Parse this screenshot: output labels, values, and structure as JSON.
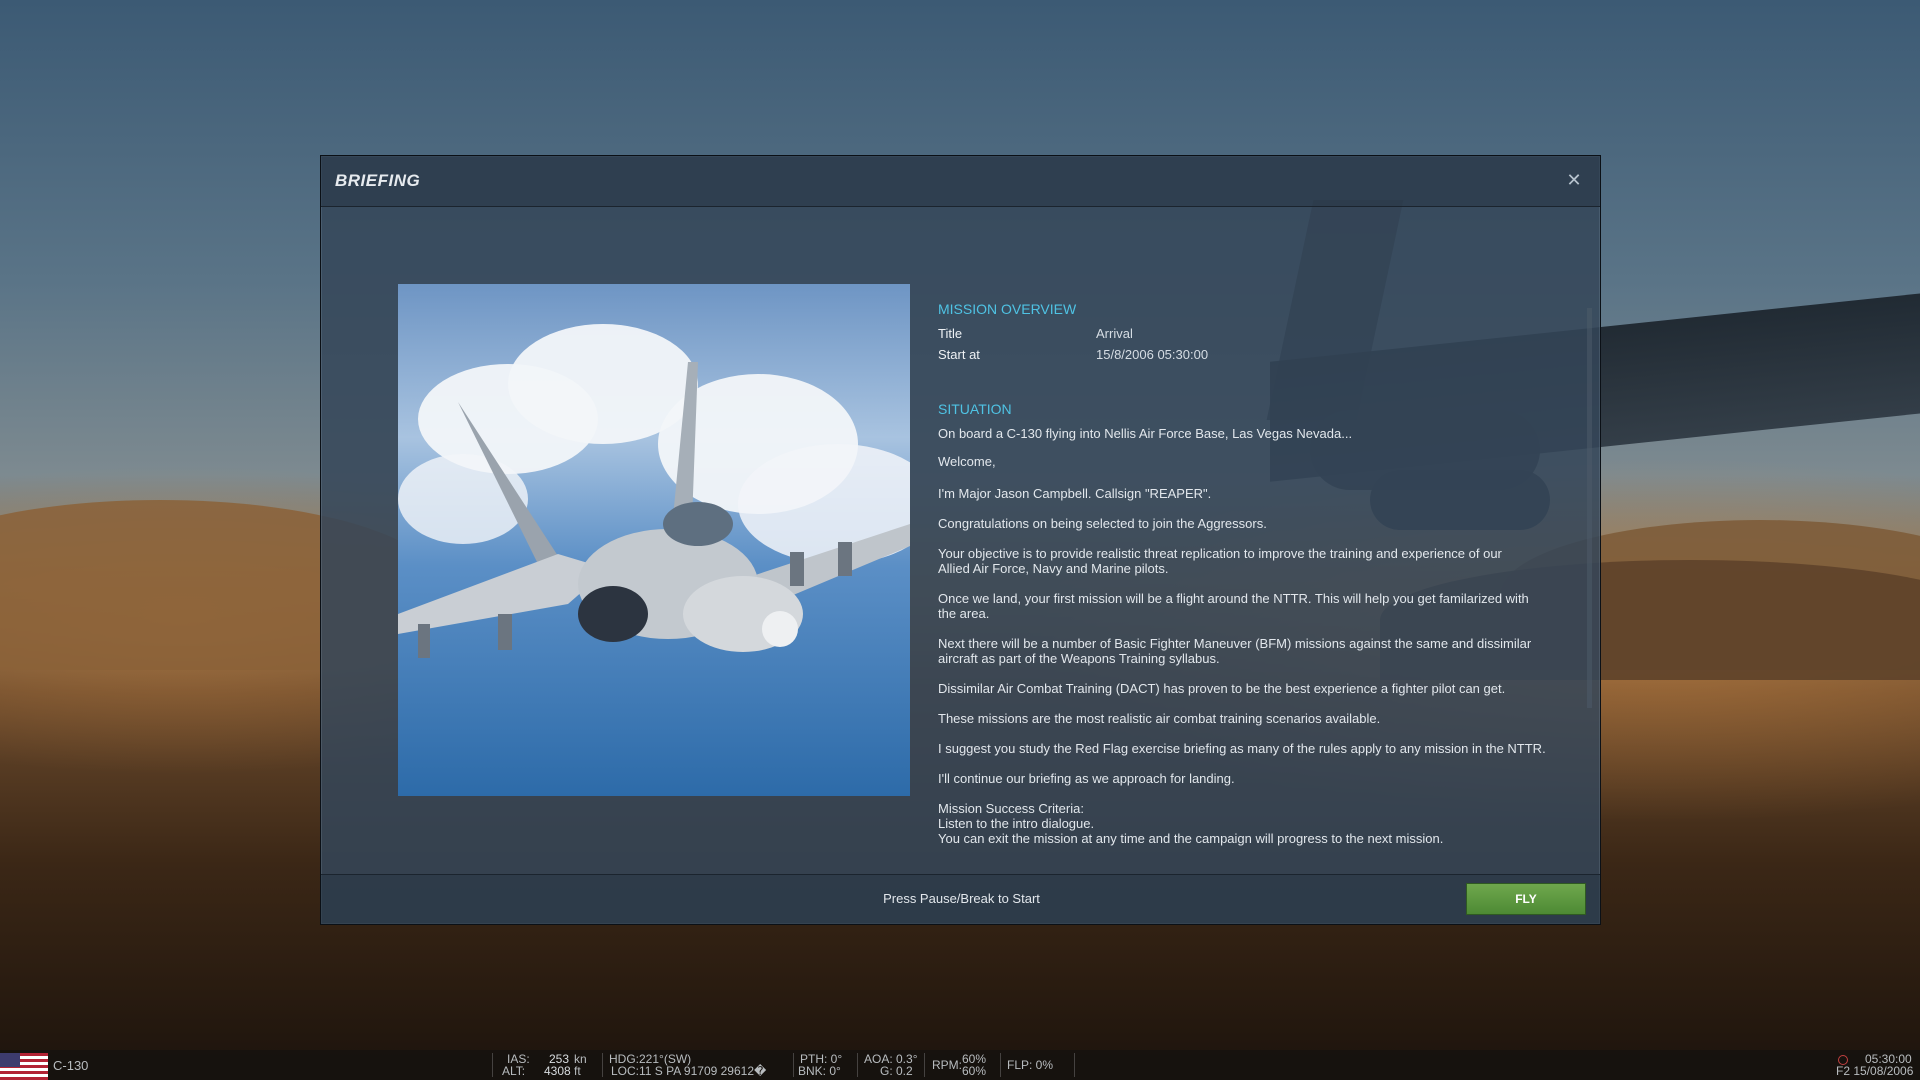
{
  "dialog": {
    "title": "BRIEFING",
    "close_icon": "close-icon"
  },
  "overview": {
    "heading": "MISSION OVERVIEW",
    "rows": [
      {
        "key": "Title",
        "value": "Arrival"
      },
      {
        "key": "Start at",
        "value": "15/8/2006  05:30:00"
      }
    ]
  },
  "situation": {
    "heading": "SITUATION",
    "paragraphs": [
      "On board a C-130 flying into Nellis Air Force Base, Las Vegas Nevada...",
      "Welcome,",
      " I'm Major Jason Campbell.  Callsign \"REAPER\".",
      "Congratulations on being selected to join the Aggressors.",
      "Your objective is to provide realistic threat replication to improve the training and experience of our\nAllied Air Force, Navy and Marine pilots.",
      "Once we land, your first mission will be a flight around the NTTR.  This will help you get familarized with\nthe area.",
      "Next there will be a number of Basic Fighter Maneuver (BFM)  missions against the same and dissimilar\naircraft as part of the Weapons Training syllabus.",
      "Dissimilar Air Combat Training (DACT) has proven to be the best experience a fighter pilot can get.",
      "These missions are the most realistic air combat training scenarios available.",
      "I suggest you study the Red Flag exercise briefing as many of the rules apply to any mission in the NTTR.",
      "I'll continue our briefing as we approach for landing.",
      "Mission Success Criteria:\nListen to the intro dialogue.\nYou can exit the mission at any time and the campaign will progress to the next mission."
    ]
  },
  "footer": {
    "hint": "Press Pause/Break to Start",
    "fly_label": "FLY",
    "fly_color": "#5e9a42"
  },
  "statusbar": {
    "aircraft": "C-130",
    "ias_label": "IAS:",
    "ias_value": "253",
    "ias_unit": "kn",
    "alt_label": "ALT:",
    "alt_value": "4308",
    "alt_unit": "ft",
    "hdg": "HDG:221°(SW)",
    "loc": "LOC:11 S PA 91709 29612�",
    "pth": "PTH: 0°",
    "bnk": "BNK: 0°",
    "aoa": "AOA: 0.3°",
    "g": "G: 0.2",
    "rpm_label": "RPM:",
    "rpm1": "60%",
    "rpm2": "60%",
    "flp": "FLP: 0%",
    "time": "05:30:00",
    "date": "F2 15/08/2006"
  },
  "accent_color": "#4fc3e4"
}
